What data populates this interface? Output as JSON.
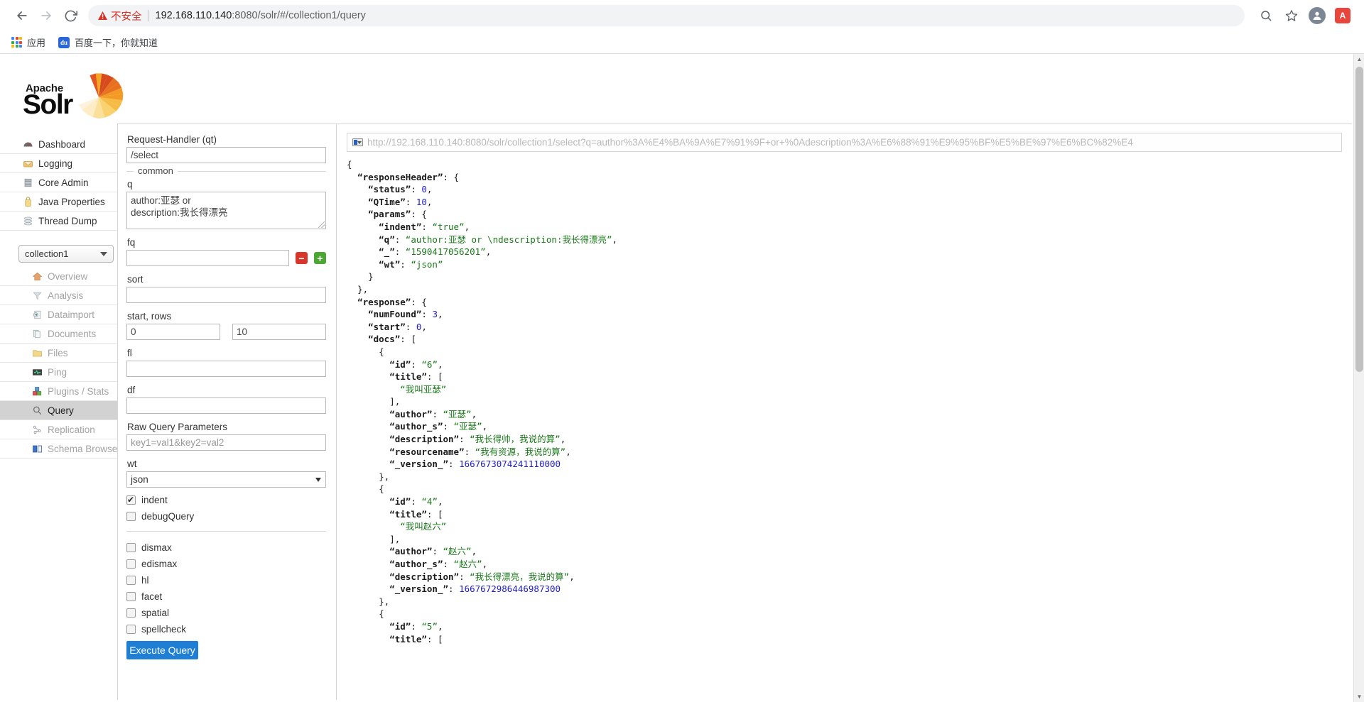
{
  "browser": {
    "back_label": "Back",
    "forward_label": "Forward",
    "reload_label": "Reload",
    "security_warning": "不安全",
    "url_host": "192.168.110.140",
    "url_rest": ":8080/solr/#/collection1/query",
    "search_icon": "search-icon",
    "bookmark_icon": "star-icon",
    "profile_icon": "profile-avatar",
    "extension_badge": "A",
    "bookmarks": [
      {
        "label": "应用",
        "icon": "apps-grid-icon"
      },
      {
        "label": "百度一下，你就知道",
        "icon": "baidu-icon"
      }
    ]
  },
  "sidebar": {
    "logo_top": "Apache",
    "logo_main": "Solr",
    "global_items": [
      {
        "label": "Dashboard",
        "icon": "dashboard-icon"
      },
      {
        "label": "Logging",
        "icon": "logging-icon"
      },
      {
        "label": "Core Admin",
        "icon": "core-admin-icon"
      },
      {
        "label": "Java Properties",
        "icon": "java-properties-icon"
      },
      {
        "label": "Thread Dump",
        "icon": "thread-dump-icon"
      }
    ],
    "core_selected": "collection1",
    "core_items": [
      {
        "label": "Overview",
        "icon": "home-icon",
        "active": false
      },
      {
        "label": "Analysis",
        "icon": "funnel-icon",
        "active": false
      },
      {
        "label": "Dataimport",
        "icon": "dataimport-icon",
        "active": false
      },
      {
        "label": "Documents",
        "icon": "documents-icon",
        "active": false
      },
      {
        "label": "Files",
        "icon": "folder-icon",
        "active": false
      },
      {
        "label": "Ping",
        "icon": "ping-icon",
        "active": false
      },
      {
        "label": "Plugins / Stats",
        "icon": "plugins-icon",
        "active": false
      },
      {
        "label": "Query",
        "icon": "magnifier-icon",
        "active": true
      },
      {
        "label": "Replication",
        "icon": "replication-icon",
        "active": false
      },
      {
        "label": "Schema Browser",
        "icon": "book-icon",
        "active": false
      }
    ]
  },
  "query_form": {
    "request_handler_label": "Request-Handler (qt)",
    "request_handler_value": "/select",
    "common_legend": "common",
    "q_label": "q",
    "q_value": "author:亚瑟 or\ndescription:我长得漂亮",
    "fq_label": "fq",
    "fq_value": "",
    "fq_remove_label": "−",
    "fq_add_label": "+",
    "sort_label": "sort",
    "sort_value": "",
    "start_rows_label": "start, rows",
    "start_value": "0",
    "rows_value": "10",
    "fl_label": "fl",
    "fl_value": "",
    "df_label": "df",
    "df_value": "",
    "raw_query_label": "Raw Query Parameters",
    "raw_query_placeholder": "key1=val1&key2=val2",
    "wt_label": "wt",
    "wt_value": "json",
    "checkboxes_top": [
      {
        "label": "indent",
        "checked": true
      },
      {
        "label": "debugQuery",
        "checked": false
      }
    ],
    "checkboxes_bottom": [
      {
        "label": "dismax",
        "checked": false
      },
      {
        "label": "edismax",
        "checked": false
      },
      {
        "label": "hl",
        "checked": false
      },
      {
        "label": "facet",
        "checked": false
      },
      {
        "label": "spatial",
        "checked": false
      },
      {
        "label": "spellcheck",
        "checked": false
      }
    ],
    "execute_label": "Execute Query"
  },
  "result": {
    "url": "http://192.168.110.140:8080/solr/collection1/select?q=author%3A%E4%BA%9A%E7%91%9F+or+%0Adescription%3A%E6%88%91%E9%95%BF%E5%BE%97%E6%BC%82%E4",
    "json_text": "{\n  \"responseHeader\": {\n    \"status\": 0,\n    \"QTime\": 10,\n    \"params\": {\n      \"indent\": \"true\",\n      \"q\": \"author:亚瑟 or \\ndescription:我长得漂亮\",\n      \"_\": \"1590417056201\",\n      \"wt\": \"json\"\n    }\n  },\n  \"response\": {\n    \"numFound\": 3,\n    \"start\": 0,\n    \"docs\": [\n      {\n        \"id\": \"6\",\n        \"title\": [\n          \"我叫亚瑟\"\n        ],\n        \"author\": \"亚瑟\",\n        \"author_s\": \"亚瑟\",\n        \"description\": \"我长得帅，我说的算\",\n        \"resourcename\": \"我有资源，我说的算\",\n        \"_version_\": 1667673074241110000\n      },\n      {\n        \"id\": \"4\",\n        \"title\": [\n          \"我叫赵六\"\n        ],\n        \"author\": \"赵六\",\n        \"author_s\": \"赵六\",\n        \"description\": \"我长得漂亮，我说的算\",\n        \"_version_\": 1667672986446987300\n      },\n      {\n        \"id\": \"5\",\n        \"title\": [",
    "response_header": {
      "status": 0,
      "QTime": 10,
      "params": {
        "indent": "true",
        "q": "author:亚瑟 or \\ndescription:我长得漂亮",
        "_": "1590417056201",
        "wt": "json"
      }
    },
    "response": {
      "numFound": 3,
      "start": 0,
      "docs": [
        {
          "id": "6",
          "title": [
            "我叫亚瑟"
          ],
          "author": "亚瑟",
          "author_s": "亚瑟",
          "description": "我长得帅，我说的算",
          "resourcename": "我有资源，我说的算",
          "_version_": "1667673074241110000"
        },
        {
          "id": "4",
          "title": [
            "我叫赵六"
          ],
          "author": "赵六",
          "author_s": "赵六",
          "description": "我长得漂亮，我说的算",
          "_version_": "1667672986446987300"
        },
        {
          "id": "5",
          "title": []
        }
      ]
    }
  },
  "colors": {
    "accent_blue": "#1f7fd4",
    "warning_red": "#d93025",
    "json_string_green": "#1a7a1a",
    "json_number_blue": "#2020d0",
    "active_nav_gray": "#d2d2d2"
  }
}
